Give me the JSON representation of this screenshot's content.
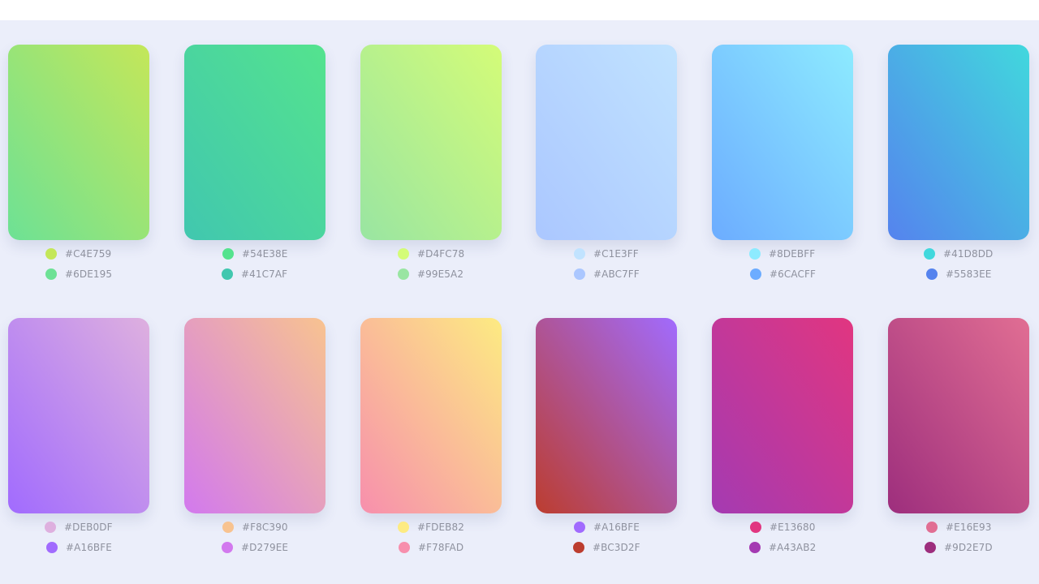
{
  "palettes": [
    {
      "colors": [
        "#C4E759",
        "#6DE195"
      ]
    },
    {
      "colors": [
        "#54E38E",
        "#41C7AF"
      ]
    },
    {
      "colors": [
        "#D4FC78",
        "#99E5A2"
      ]
    },
    {
      "colors": [
        "#C1E3FF",
        "#ABC7FF"
      ]
    },
    {
      "colors": [
        "#8DEBFF",
        "#6CACFF"
      ]
    },
    {
      "colors": [
        "#41D8DD",
        "#5583EE"
      ]
    },
    {
      "colors": [
        "#DEB0DF",
        "#A16BFE"
      ]
    },
    {
      "colors": [
        "#F8C390",
        "#D279EE"
      ]
    },
    {
      "colors": [
        "#FDEB82",
        "#F78FAD"
      ]
    },
    {
      "colors": [
        "#A16BFE",
        "#BC3D2F"
      ]
    },
    {
      "colors": [
        "#E13680",
        "#A43AB2"
      ]
    },
    {
      "colors": [
        "#E16E93",
        "#9D2E7D"
      ]
    }
  ]
}
